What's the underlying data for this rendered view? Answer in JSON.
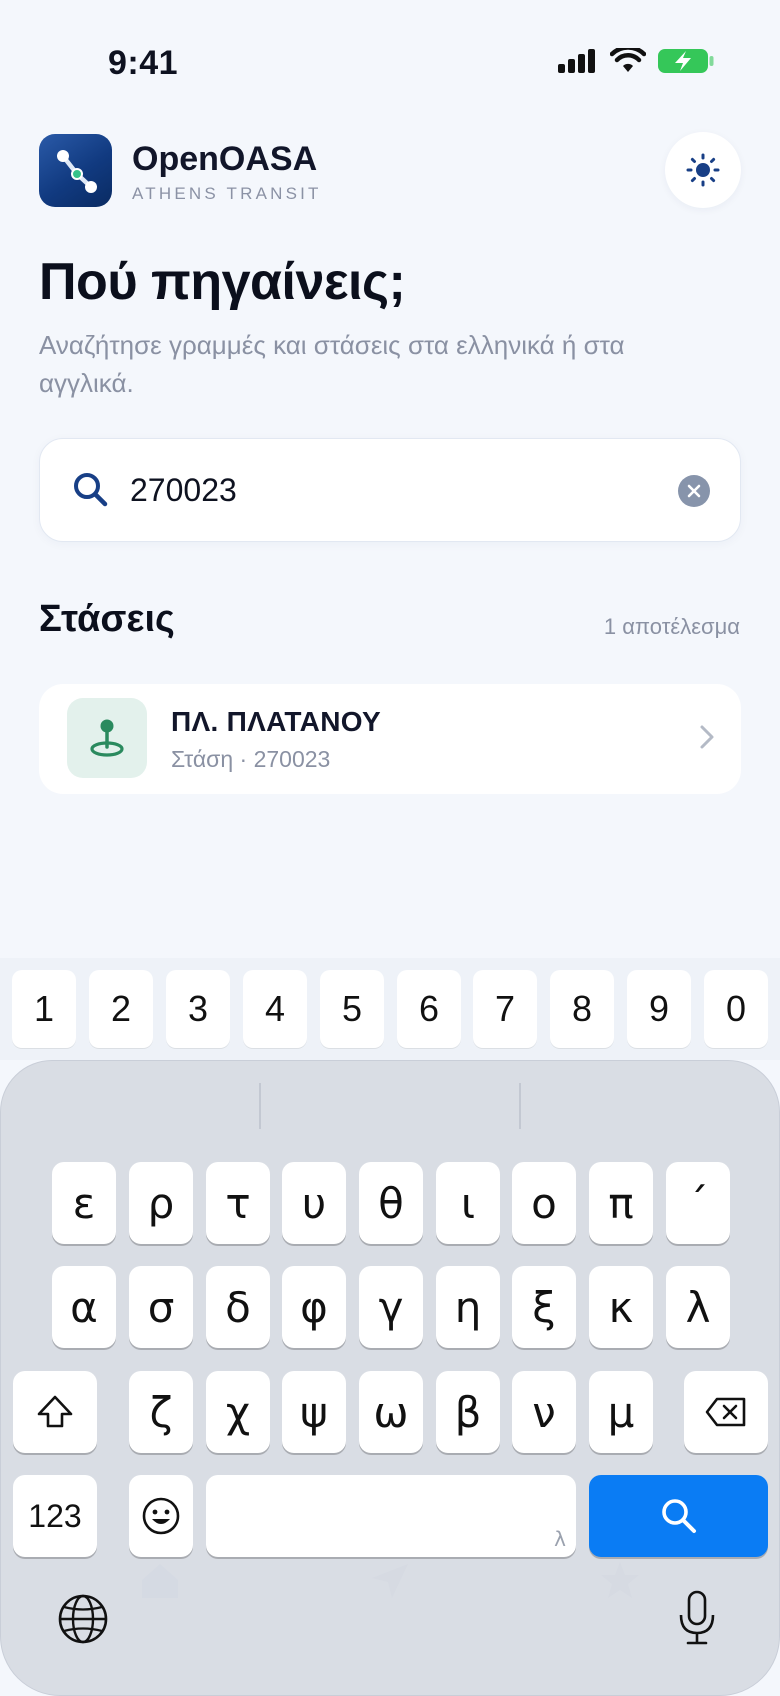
{
  "status_bar": {
    "time": "9:41"
  },
  "header": {
    "app_name": "OpenOASA",
    "app_subtitle": "ATHENS TRANSIT"
  },
  "hero": {
    "title": "Πού πηγαίνεις;",
    "subtitle": "Αναζήτησε γραμμές και στάσεις στα ελληνικά ή στα αγγλικά."
  },
  "search": {
    "value": "270023"
  },
  "results": {
    "section_title": "Στάσεις",
    "count": "1 αποτέλεσμα",
    "items": [
      {
        "name": "ΠΛ. ΠΛΑΤΑΝΟΥ",
        "meta": "Στάση · 270023"
      }
    ]
  },
  "keyboard": {
    "numbers": [
      "1",
      "2",
      "3",
      "4",
      "5",
      "6",
      "7",
      "8",
      "9",
      "0"
    ],
    "row1": [
      "ε",
      "ρ",
      "τ",
      "υ",
      "θ",
      "ι",
      "ο",
      "π",
      "´"
    ],
    "row2": [
      "α",
      "σ",
      "δ",
      "φ",
      "γ",
      "η",
      "ξ",
      "κ",
      "λ"
    ],
    "row3": [
      "ζ",
      "χ",
      "ψ",
      "ω",
      "β",
      "ν",
      "μ"
    ],
    "mode_key": "123",
    "space_hint": "λ"
  },
  "colors": {
    "accent": "#0a7cf4",
    "brand": "#1a4a94",
    "stop_green": "#2a8a5e"
  }
}
